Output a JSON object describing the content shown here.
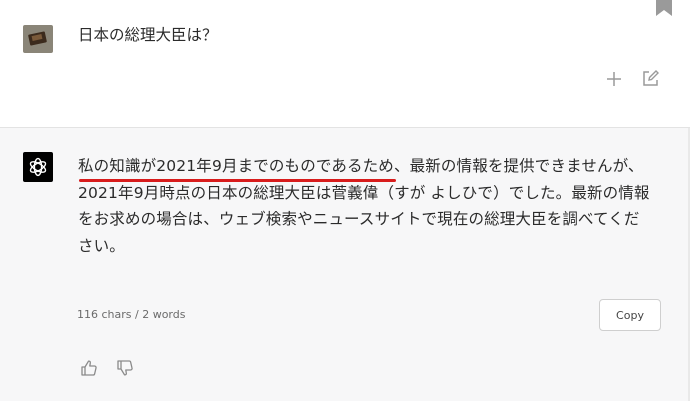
{
  "user_message": {
    "text": "日本の総理大臣は？"
  },
  "assistant_message": {
    "lines": [
      "私の知識が2021年9月までのものであるため、最新の情報を提供できませんが、",
      "2021年9月時点の日本の総理大臣は菅義偉（すが よしひで）でした。最新の情報",
      "をお求めの場合は、ウェブ検索やニュースサイトで現在の総理大臣を調べてくだ",
      "さい。"
    ],
    "counter": "116 chars / 2 words",
    "copy_label": "Copy"
  },
  "icons": {
    "bookmark": "bookmark-icon",
    "add": "plus-icon",
    "edit": "edit-icon",
    "assistant_logo": "openai-logo-icon",
    "like": "thumbs-up-icon",
    "dislike": "thumbs-down-icon"
  },
  "colors": {
    "highlight_underline": "#d81c1c",
    "assistant_bg": "#f7f7f8",
    "logo_bg": "#000000"
  }
}
